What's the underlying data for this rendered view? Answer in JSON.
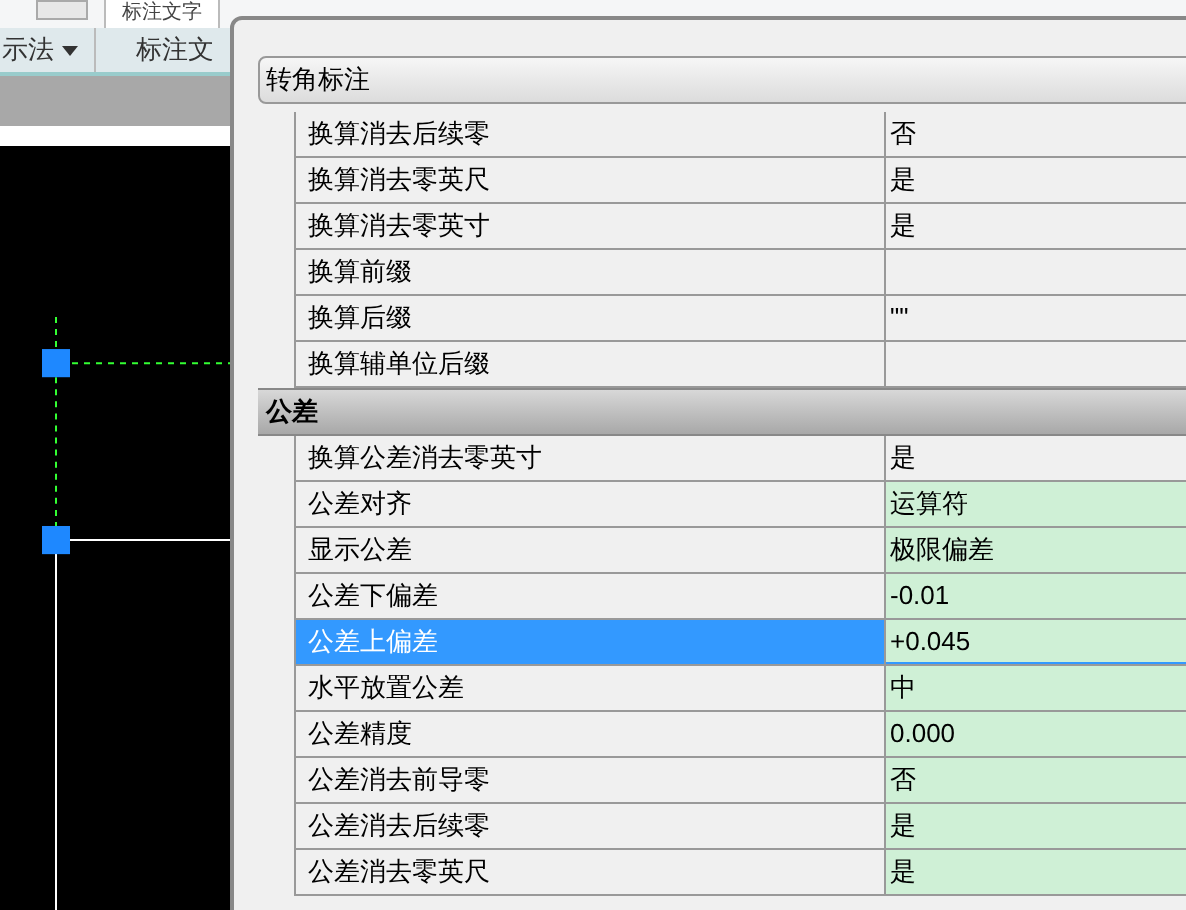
{
  "top_strip": {
    "label": "标注文字"
  },
  "ribbon": {
    "panels": [
      {
        "label": "示法",
        "dropdown": true
      },
      {
        "label": "标注文",
        "dropdown": false
      }
    ]
  },
  "properties": {
    "dropdown": "转角标注",
    "sections": [
      {
        "rows": [
          {
            "name": "换算消去后续零",
            "value": "否",
            "overridden": false,
            "selected": false
          },
          {
            "name": "换算消去零英尺",
            "value": "是",
            "overridden": false,
            "selected": false
          },
          {
            "name": "换算消去零英寸",
            "value": "是",
            "overridden": false,
            "selected": false
          },
          {
            "name": "换算前缀",
            "value": null,
            "overridden": false,
            "selected": false
          },
          {
            "name": "换算后缀",
            "value": "\"\"",
            "overridden": false,
            "selected": false
          },
          {
            "name": "换算辅单位后缀",
            "value": null,
            "overridden": false,
            "selected": false
          }
        ]
      },
      {
        "title": "公差",
        "rows": [
          {
            "name": "换算公差消去零英寸",
            "value": "是",
            "overridden": false,
            "selected": false
          },
          {
            "name": "公差对齐",
            "value": "运算符",
            "overridden": true,
            "selected": false
          },
          {
            "name": "显示公差",
            "value": "极限偏差",
            "overridden": true,
            "selected": false
          },
          {
            "name": "公差下偏差",
            "value": "-0.01",
            "overridden": true,
            "selected": false
          },
          {
            "name": "公差上偏差",
            "value": "+0.045",
            "overridden": true,
            "selected": true
          },
          {
            "name": "水平放置公差",
            "value": "中",
            "overridden": true,
            "selected": false
          },
          {
            "name": "公差精度",
            "value": "0.000",
            "overridden": true,
            "selected": false
          },
          {
            "name": "公差消去前导零",
            "value": "否",
            "overridden": true,
            "selected": false
          },
          {
            "name": "公差消去后续零",
            "value": "是",
            "overridden": true,
            "selected": false
          },
          {
            "name": "公差消去零英尺",
            "value": "是",
            "overridden": true,
            "selected": false
          }
        ]
      }
    ]
  }
}
